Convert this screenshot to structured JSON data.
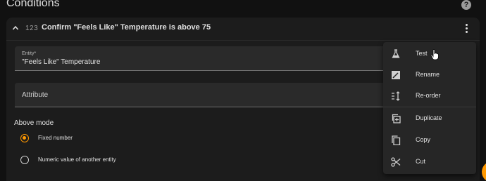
{
  "section": {
    "title": "Conditions",
    "help_icon": "help-circle-icon"
  },
  "condition_card": {
    "type_icon_text": "123",
    "title": "Confirm \"Feels Like\" Temperature is above 75",
    "entity_field": {
      "label": "Entity*",
      "value": "\"Feels Like\" Temperature"
    },
    "attribute_field": {
      "label": "Attribute"
    },
    "mode": {
      "label": "Above mode",
      "options": [
        {
          "label": "Fixed number",
          "checked": true
        },
        {
          "label": "Numeric value of another entity",
          "checked": false
        }
      ]
    }
  },
  "overflow_menu": {
    "items": [
      {
        "label": "Test",
        "icon": "flask-icon"
      },
      {
        "label": "Rename",
        "icon": "rename-icon"
      },
      {
        "label": "Re-order",
        "icon": "reorder-icon"
      },
      {
        "label": "Duplicate",
        "icon": "duplicate-icon"
      },
      {
        "label": "Copy",
        "icon": "copy-icon"
      },
      {
        "label": "Cut",
        "icon": "scissors-icon"
      }
    ]
  },
  "colors": {
    "accent": "#ff9800",
    "card": "#1c1c1c",
    "menu": "#262626"
  }
}
